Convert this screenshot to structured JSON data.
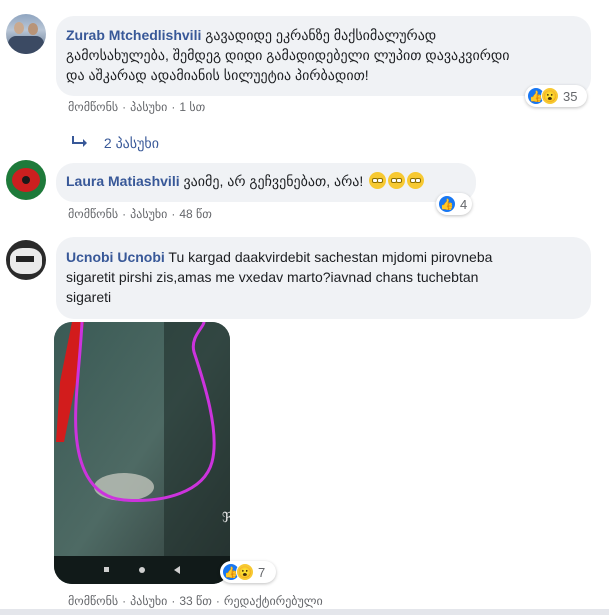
{
  "comments": [
    {
      "author": "Zurab Mtchedlishvili",
      "text_line1": "გავადიდე ეკრანზე მაქსიმალურად",
      "text_line2": "გამოსახულება, შემდეგ დიდი გამადიდებელი ლუპით დავაკვირდი",
      "text_line3": "და აშკარად ადამიანის სილუეტია პირბადით!",
      "like_label": "მომწონს",
      "reply_label": "პასუხი",
      "time": "1 სთ",
      "reaction_count": "35"
    },
    {
      "author": "Laura Matiashvili",
      "text": "ვაიმე, არ გეჩვენებათ, არა!",
      "like_label": "მომწონს",
      "reply_label": "პასუხი",
      "time": "48 წთ",
      "reaction_count": "4"
    },
    {
      "author": "Ucnobi Ucnobi",
      "text_line1": "Tu kargad daakvirdebit sachestan mjdomi pirovneba",
      "text_line2": "sigaretit pirshi zis,amas me vxedav marto?iavnad chans tuchebtan",
      "text_line3": "sigareti",
      "like_label": "მომწონს",
      "reply_label": "პასუხი",
      "time": "33 წთ",
      "edited_label": "რედაქტირებული",
      "reaction_count": "7"
    }
  ],
  "replies_link": "2 პასუხი",
  "icons": [
    "reply-arrow-icon",
    "like-reaction-icon",
    "wow-reaction-icon",
    "eye-roll-emoji-icon"
  ],
  "colors": {
    "author": "#385898",
    "bubble": "#f0f2f5",
    "like": "#1877f2",
    "wow": "#f7c932",
    "reply_link": "#385898"
  }
}
